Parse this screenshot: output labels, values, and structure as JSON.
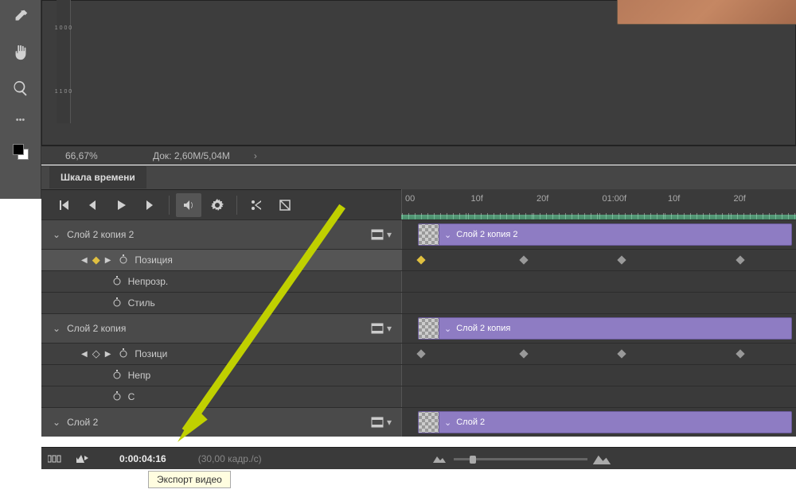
{
  "status": {
    "zoom": "66,67%",
    "doc": "Док: 2,60M/5,04M"
  },
  "panel": {
    "title": "Шкала времени"
  },
  "ruler": [
    "00",
    "10f",
    "20f",
    "01:00f",
    "10f",
    "20f"
  ],
  "layers": [
    {
      "name": "Слой 2 копия 2",
      "clip_label": "Слой 2 копия 2",
      "props": [
        {
          "label": "Позиция",
          "selected": true,
          "kfnav": true,
          "kfcolor": "y"
        },
        {
          "label": "Непрозр.",
          "selected": false
        },
        {
          "label": "Стиль",
          "selected": false
        }
      ]
    },
    {
      "name": "Слой 2 копия",
      "clip_label": "Слой 2 копия",
      "props": [
        {
          "label": "Позиция",
          "truncated": "Позици",
          "kfnav": true,
          "kfcolor": "g"
        },
        {
          "label": "Непрозр.",
          "truncated": "Непр"
        },
        {
          "label": "Стиль",
          "truncated": "С"
        }
      ]
    },
    {
      "name": "Слой 2",
      "clip_label": "Слой 2",
      "props": []
    }
  ],
  "footer": {
    "timecode": "0:00:04:16",
    "fps": "(30,00 кадр./c)"
  },
  "tooltip": "Экспорт видео",
  "keyframe_positions_pct": [
    4,
    30,
    55,
    85
  ]
}
